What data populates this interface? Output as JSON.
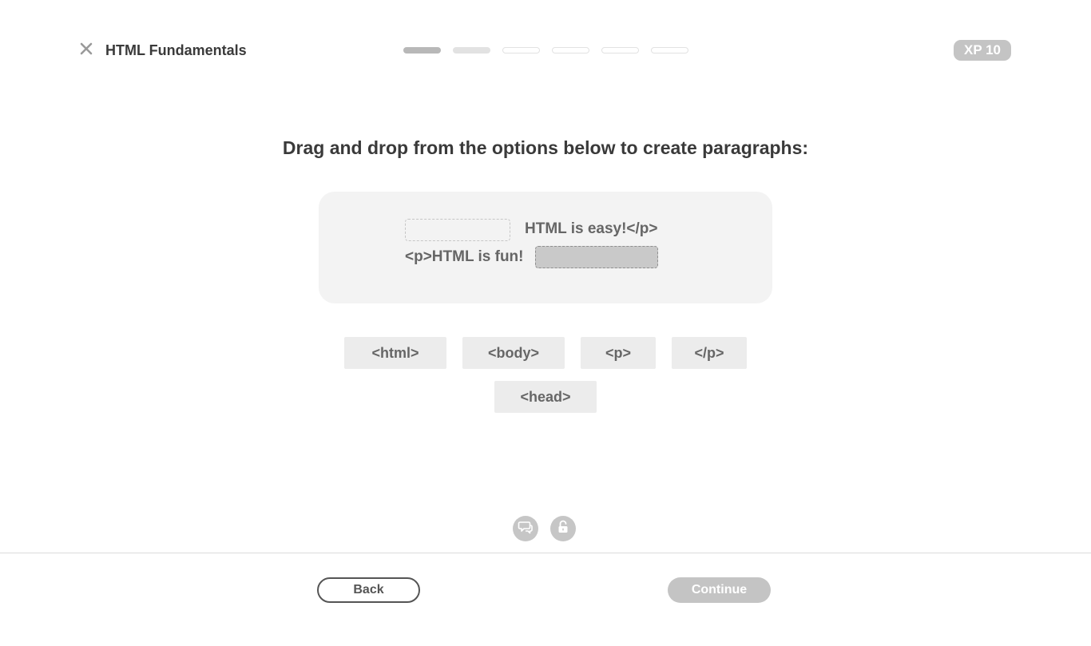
{
  "header": {
    "title": "HTML Fundamentals",
    "close_icon": "close-icon",
    "xp_badge": "XP 10",
    "progress": {
      "total_steps": 6,
      "completed_steps": 1,
      "current_step": 2
    }
  },
  "question": {
    "prompt": "Drag and drop from the options below to create paragraphs:",
    "lines": [
      {
        "slot_first": true,
        "text": "HTML is easy!</p>"
      },
      {
        "slot_first": false,
        "text": "<p>HTML is fun!"
      }
    ]
  },
  "options": [
    {
      "label": "<html>"
    },
    {
      "label": "<body>"
    },
    {
      "label": "<p>"
    },
    {
      "label": "</p>"
    },
    {
      "label": "<head>"
    }
  ],
  "help": {
    "comments_icon": "comments-icon",
    "unlock_icon": "unlock-icon"
  },
  "footer": {
    "back_label": "Back",
    "continue_label": "Continue"
  },
  "colors": {
    "accent_disabled": "#c4c4c4",
    "text_primary": "#3a3a3a",
    "text_muted": "#666666",
    "panel_bg": "#f3f3f3",
    "option_bg": "#ececec"
  }
}
